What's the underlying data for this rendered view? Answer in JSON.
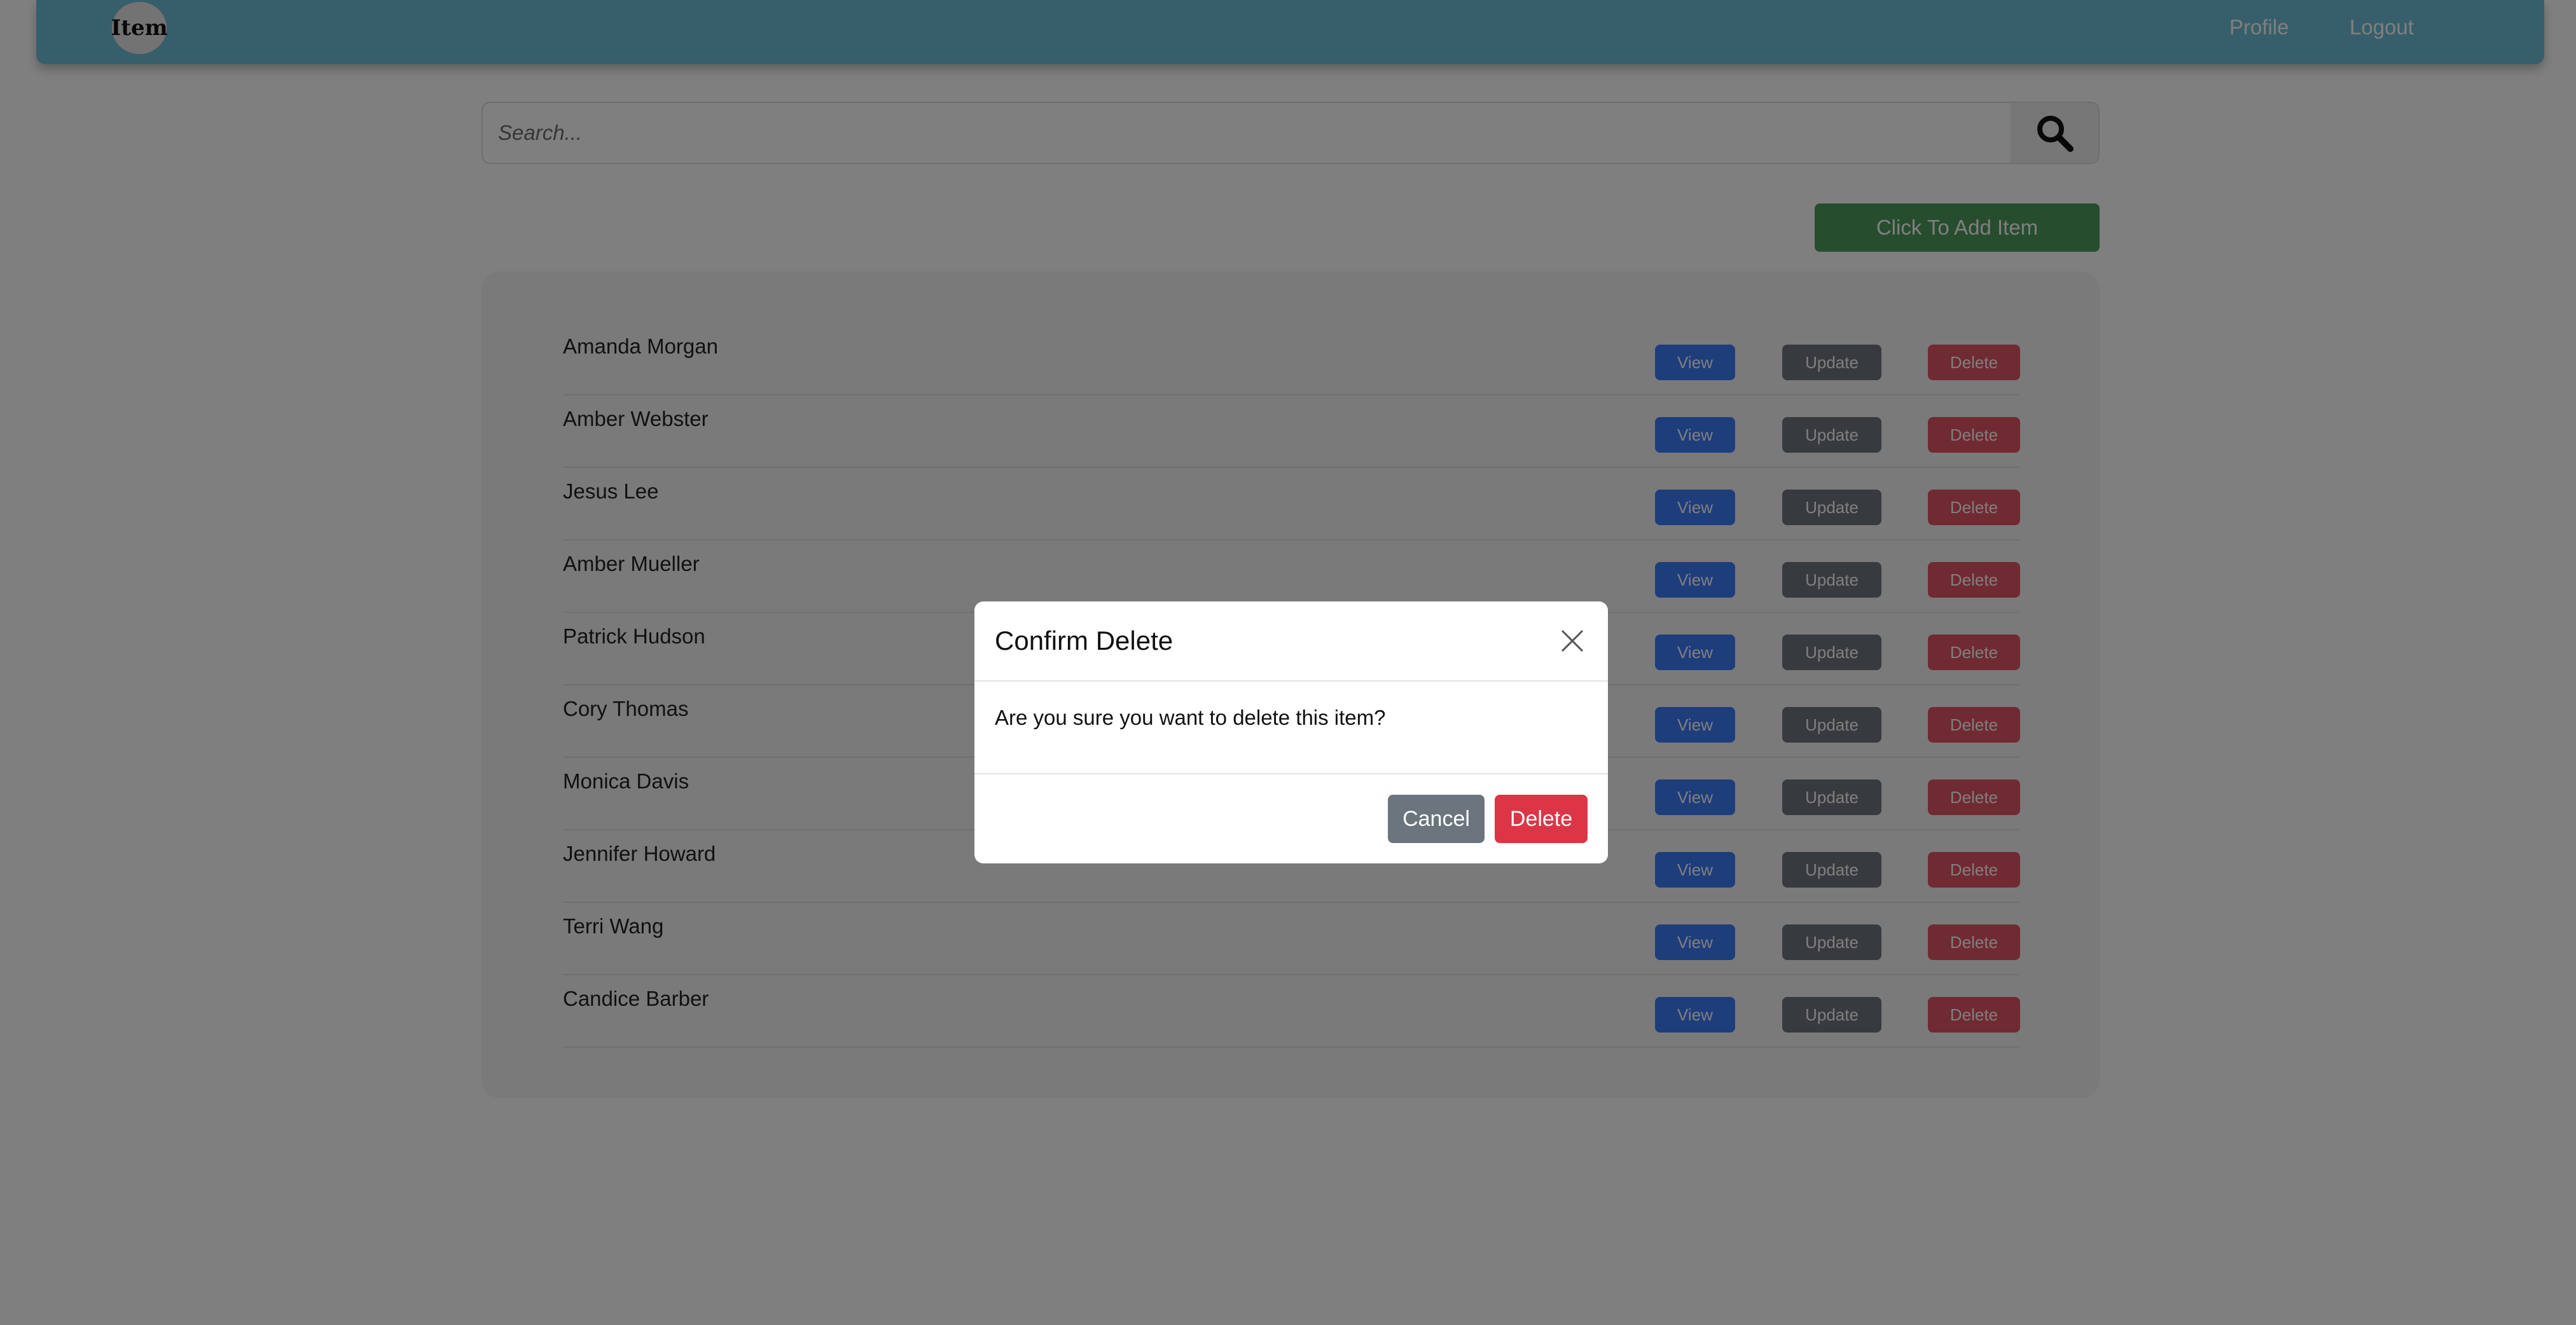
{
  "navbar": {
    "brand": "Item",
    "links": [
      "Profile",
      "Logout"
    ]
  },
  "search": {
    "placeholder": "Search...",
    "icon": "search-icon"
  },
  "add_button": "Click To Add Item",
  "items": [
    "Amanda Morgan",
    "Amber Webster",
    "Jesus Lee",
    "Amber Mueller",
    "Patrick Hudson",
    "Cory Thomas",
    "Monica Davis",
    "Jennifer Howard",
    "Terri Wang",
    "Candice Barber"
  ],
  "row_actions": {
    "view": "View",
    "update": "Update",
    "delete": "Delete"
  },
  "modal": {
    "title": "Confirm Delete",
    "message": "Are you sure you want to delete this item?",
    "cancel": "Cancel",
    "confirm": "Delete",
    "close_icon": "close-icon"
  },
  "colors": {
    "navbar": "#6fbfd6",
    "view": "#3d7bf7",
    "update": "#6f757c",
    "delete": "#e05564",
    "add": "#4e9a5f"
  }
}
